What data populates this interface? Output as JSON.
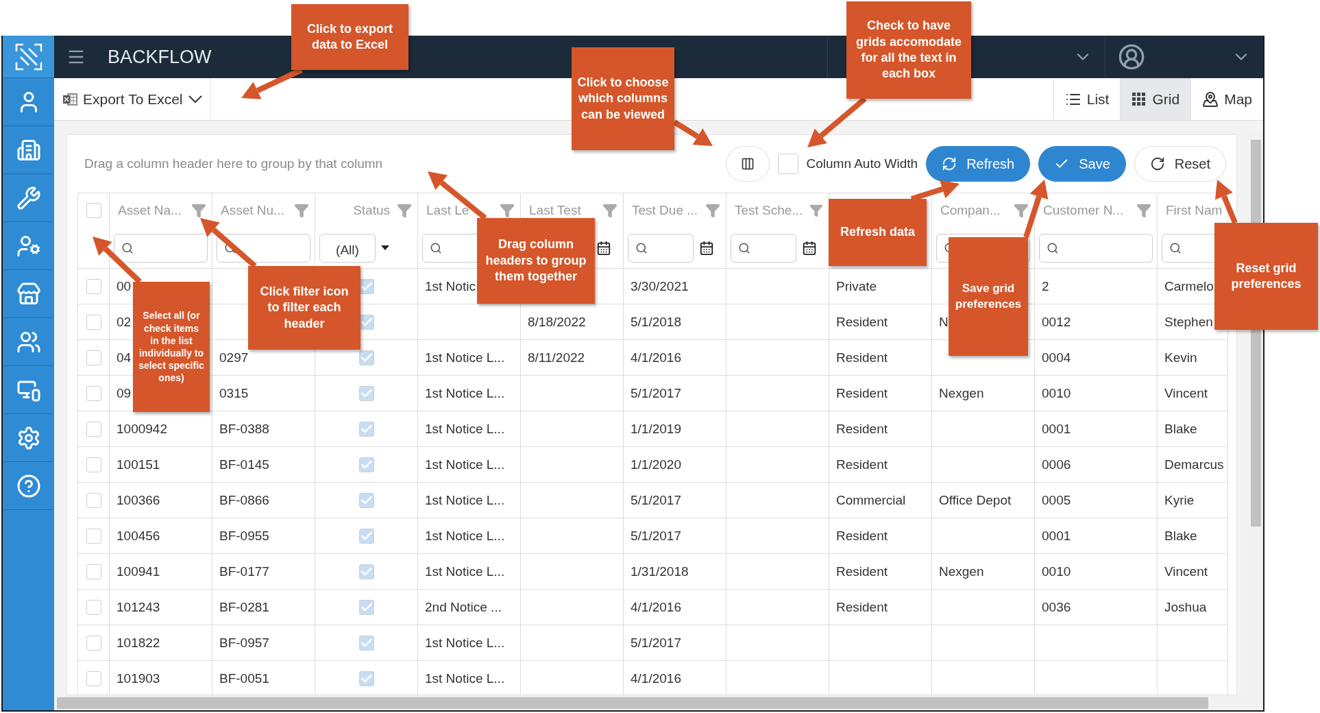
{
  "app": {
    "title": "BACKFLOW"
  },
  "toolbar": {
    "export_label": "Export To Excel",
    "views": [
      {
        "label": "List",
        "kind": "list",
        "selected": false
      },
      {
        "label": "Grid",
        "kind": "grid",
        "selected": true
      },
      {
        "label": "Map",
        "kind": "map",
        "selected": false
      }
    ]
  },
  "grid": {
    "group_hint": "Drag a column header here to group by that column",
    "auto_width": {
      "label": "Column Auto Width",
      "checked": false
    },
    "buttons": [
      {
        "label": "Refresh",
        "kind": "refresh"
      },
      {
        "label": "Save",
        "kind": "save"
      },
      {
        "label": "Reset",
        "kind": "reset"
      }
    ],
    "select_all": {
      "checked": false
    },
    "columns": [
      {
        "label": "Asset Na...",
        "kind": "text",
        "filter": {
          "kind": "search"
        },
        "filter_icon": true
      },
      {
        "label": "Asset Nu...",
        "kind": "text",
        "filter": {
          "kind": "search"
        },
        "filter_icon": true
      },
      {
        "label": "Status",
        "kind": "check",
        "filter": {
          "kind": "select",
          "value": "(All)"
        },
        "filter_icon": true
      },
      {
        "label": "Last Le",
        "kind": "text",
        "filter": {
          "kind": "search"
        },
        "filter_icon": true
      },
      {
        "label": "Last Test",
        "kind": "text",
        "filter": {
          "kind": "date"
        },
        "filter_icon": true
      },
      {
        "label": "Test Due ...",
        "kind": "text",
        "filter": {
          "kind": "date"
        },
        "filter_icon": true
      },
      {
        "label": "Test Sche...",
        "kind": "text",
        "filter": {
          "kind": "date"
        },
        "filter_icon": true
      },
      {
        "kind": "text"
      },
      {
        "label": "Compan...",
        "kind": "text",
        "filter": {
          "kind": "search"
        },
        "filter_icon": true
      },
      {
        "label": "Customer N...",
        "kind": "text",
        "filter": {
          "kind": "search"
        },
        "filter_icon": true
      },
      {
        "label": "First Nam",
        "kind": "text",
        "filter": {
          "kind": "search"
        },
        "filter_icon": false
      }
    ],
    "rows": [
      {
        "checked": false,
        "cells": [
          "00",
          null,
          {
            "checked": true
          },
          "1st Notic",
          null,
          "3/30/2021",
          null,
          "Private",
          null,
          "2",
          "Carmelo"
        ]
      },
      {
        "checked": false,
        "cells": [
          "02",
          null,
          {
            "checked": true
          },
          null,
          "8/18/2022",
          "5/1/2018",
          null,
          "Resident",
          "N",
          "0012",
          "Stephen"
        ]
      },
      {
        "checked": false,
        "cells": [
          "04",
          "0297",
          {
            "checked": true
          },
          "1st Notice L...",
          "8/11/2022",
          "4/1/2016",
          null,
          "Resident",
          null,
          "0004",
          "Kevin"
        ]
      },
      {
        "checked": false,
        "cells": [
          "09",
          "0315",
          {
            "checked": true
          },
          "1st Notice L...",
          null,
          "5/1/2017",
          null,
          "Resident",
          "Nexgen",
          "0010",
          "Vincent"
        ]
      },
      {
        "checked": false,
        "cells": [
          "1000942",
          "BF-0388",
          {
            "checked": true
          },
          "1st Notice L...",
          null,
          "1/1/2019",
          null,
          "Resident",
          null,
          "0001",
          "Blake"
        ]
      },
      {
        "checked": false,
        "cells": [
          "100151",
          "BF-0145",
          {
            "checked": true
          },
          "1st Notice L...",
          null,
          "1/1/2020",
          null,
          "Resident",
          null,
          "0006",
          "Demarcus"
        ]
      },
      {
        "checked": false,
        "cells": [
          "100366",
          "BF-0866",
          {
            "checked": true
          },
          "1st Notice L...",
          null,
          "5/1/2017",
          null,
          "Commercial",
          "Office Depot",
          "0005",
          "Kyrie"
        ]
      },
      {
        "checked": false,
        "cells": [
          "100456",
          "BF-0955",
          {
            "checked": true
          },
          "1st Notice L...",
          null,
          "5/1/2017",
          null,
          "Resident",
          null,
          "0001",
          "Blake"
        ]
      },
      {
        "checked": false,
        "cells": [
          "100941",
          "BF-0177",
          {
            "checked": true
          },
          "1st Notice L...",
          null,
          "1/31/2018",
          null,
          "Resident",
          "Nexgen",
          "0010",
          "Vincent"
        ]
      },
      {
        "checked": false,
        "cells": [
          "101243",
          "BF-0281",
          {
            "checked": true
          },
          "2nd Notice ...",
          null,
          "4/1/2016",
          null,
          "Resident",
          null,
          "0036",
          "Joshua"
        ]
      },
      {
        "checked": false,
        "cells": [
          "101822",
          "BF-0957",
          {
            "checked": true
          },
          "1st Notice L...",
          null,
          "5/1/2017",
          null,
          null,
          null,
          null,
          null
        ]
      },
      {
        "checked": false,
        "cells": [
          "101903",
          "BF-0051",
          {
            "checked": true
          },
          "1st Notice L...",
          null,
          "4/1/2016",
          null,
          null,
          null,
          null,
          null
        ]
      }
    ]
  },
  "callouts": [
    {
      "text": "Click to export data to Excel"
    },
    {
      "text": "Click to choose which columns can be viewed"
    },
    {
      "text": "Check to have grids accomodate for all the text in each box"
    },
    {
      "text": "Drag column headers to group them together"
    },
    {
      "text": "Select all (or check items in the list individually to select specific ones)"
    },
    {
      "text": "Click filter icon to filter each header"
    },
    {
      "text": "Refresh data"
    },
    {
      "text": "Save grid preferences"
    },
    {
      "text": "Reset grid preferences"
    }
  ]
}
